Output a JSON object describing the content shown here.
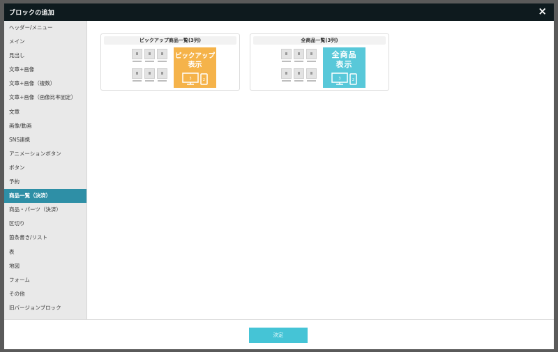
{
  "dialog": {
    "title": "ブロックの追加",
    "close_label": "×"
  },
  "sidebar": {
    "items": [
      {
        "label": "ヘッダー/メニュー",
        "active": false
      },
      {
        "label": "メイン",
        "active": false
      },
      {
        "label": "見出し",
        "active": false
      },
      {
        "label": "文章+画像",
        "active": false
      },
      {
        "label": "文章+画像（複数）",
        "active": false
      },
      {
        "label": "文章+画像（画像比率固定）",
        "active": false
      },
      {
        "label": "文章",
        "active": false
      },
      {
        "label": "画像/動画",
        "active": false
      },
      {
        "label": "SNS連携",
        "active": false
      },
      {
        "label": "アニメーションボタン",
        "active": false
      },
      {
        "label": "ボタン",
        "active": false
      },
      {
        "label": "予約",
        "active": false
      },
      {
        "label": "商品一覧（決済）",
        "active": true
      },
      {
        "label": "商品・パーツ（決済）",
        "active": false
      },
      {
        "label": "区切り",
        "active": false
      },
      {
        "label": "箇条書き/リスト",
        "active": false
      },
      {
        "label": "表",
        "active": false
      },
      {
        "label": "地図",
        "active": false
      },
      {
        "label": "フォーム",
        "active": false
      },
      {
        "label": "その他",
        "active": false
      },
      {
        "label": "旧バージョンブロック",
        "active": false
      }
    ]
  },
  "cards": [
    {
      "title": "ピックアップ商品一覧(3列)",
      "promo_line1": "ピックアップ",
      "promo_line2": "表示",
      "promo_color": "#f5b34a"
    },
    {
      "title": "全商品一覧(3列)",
      "promo_line1": "全商品",
      "promo_line2": "表示",
      "promo_color": "#58c8d9"
    }
  ],
  "footer": {
    "confirm_label": "決定",
    "confirm_color": "#45c4d6"
  },
  "colors": {
    "header_bg": "#0e1a1e",
    "sidebar_active": "#2e8fa6",
    "sidebar_bg": "#e9e9e9"
  }
}
